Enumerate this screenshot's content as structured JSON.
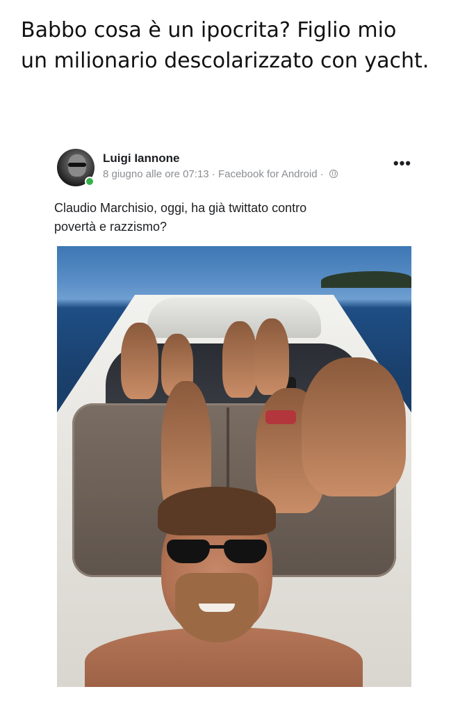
{
  "caption": {
    "line1": "Babbo cosa è un ipocrita? Figlio mio",
    "line2": "un milionario descolarizzato con yacht."
  },
  "post": {
    "author": "Luigi Iannone",
    "meta": "8 giugno alle ore 07:13 · Facebook for Android ·",
    "text_line1": "Claudio Marchisio, oggi, ha già twittato contro",
    "text_line2": "povertà e razzismo?",
    "more_icon": "more-dots-icon",
    "privacy_icon": "globe-icon",
    "online_status_color": "#35b34a"
  }
}
